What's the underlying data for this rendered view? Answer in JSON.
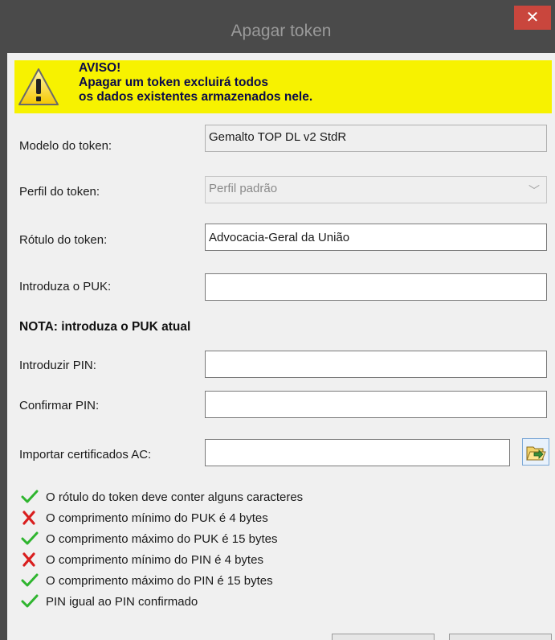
{
  "window": {
    "title": "Apagar token",
    "close_glyph": "✕"
  },
  "warning": {
    "lines": [
      "AVISO!",
      "Apagar um token excluirá todos",
      "os dados existentes armazenados nele."
    ],
    "icon": "warning-icon",
    "background": "#f7f200"
  },
  "form": {
    "model_label": "Modelo do token:",
    "model_value": "Gemalto TOP DL v2 StdR",
    "profile_label": "Perfil do token:",
    "profile_value": "Perfil padrão",
    "tag_label": "Rótulo do token:",
    "tag_value": "Advocacia-Geral da União",
    "puk_label": "Introduza o PUK:",
    "puk_value": "",
    "note": "NOTA: introduza o PUK atual",
    "pin_label": "Introduzir PIN:",
    "pin_value": "",
    "confirm_label": "Confirmar PIN:",
    "confirm_value": "",
    "import_label": "Importar certificados AC:",
    "import_value": "",
    "import_icon": "folder-open-icon"
  },
  "checks": [
    {
      "ok": true,
      "text": "O rótulo do token deve conter alguns caracteres"
    },
    {
      "ok": false,
      "text": "O comprimento mínimo do PUK é 4 bytes"
    },
    {
      "ok": true,
      "text": "O comprimento máximo do PUK é 15 bytes"
    },
    {
      "ok": false,
      "text": "O comprimento mínimo do PIN é 4 bytes"
    },
    {
      "ok": true,
      "text": "O comprimento máximo do PIN é 15 bytes"
    },
    {
      "ok": true,
      "text": "PIN igual ao PIN confirmado"
    }
  ],
  "colors": {
    "ok": "#2fb52f",
    "fail": "#d91e1e",
    "close": "#c9463d",
    "titlebar": "#4a4a4a"
  }
}
